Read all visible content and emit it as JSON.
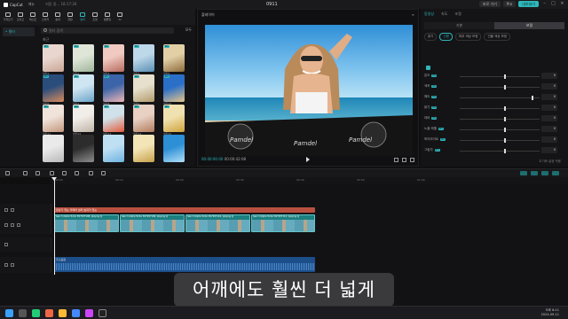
{
  "app": {
    "name": "CapCut",
    "menu": "메뉴",
    "autosave": "저장 중... 18:17:26",
    "project_title": "0911",
    "shortcut_label": "바로 가기",
    "pro_label": "Pro",
    "export_label": "내보내기"
  },
  "toolbar": {
    "items": [
      "가져오기",
      "오디오",
      "텍스트",
      "스티커",
      "효과",
      "전환",
      "필터",
      "조정",
      "템플릿",
      "AI"
    ]
  },
  "sidebar": {
    "items": [
      "• 필터"
    ]
  },
  "media": {
    "search_placeholder": "필터 검색",
    "filter_label": "모두",
    "section_title": "최근",
    "thumb_names": [
      "필터1",
      "필터2",
      "필터3",
      "필터4",
      "필터5",
      "필터6",
      "필터7",
      "필터8",
      "필터9",
      "필터10",
      "필터11",
      "필터12",
      "필터13",
      "필터14",
      "필터15",
      "",
      "",
      "",
      "",
      ""
    ]
  },
  "player": {
    "header": "플레이어",
    "current_time": "00:00:00:00",
    "total_time": "00:00:42:08",
    "brand_on_deck": "Pamdel"
  },
  "inspector": {
    "tabs": [
      "동영상",
      "속도",
      "조정"
    ],
    "subtabs": [
      "기본",
      "보정"
    ],
    "chips": [
      "밝기",
      "선명",
      "피부 색상 보정",
      "인물 색상 보정"
    ],
    "props": [
      {
        "label": "온도",
        "value": "0"
      },
      {
        "label": "색조",
        "value": "0"
      },
      {
        "label": "채도",
        "value": "0"
      },
      {
        "label": "밝기",
        "value": "0"
      },
      {
        "label": "대비",
        "value": "0"
      },
      {
        "label": "노출 레벨",
        "value": "0"
      },
      {
        "label": "하이라이트",
        "value": "0"
      },
      {
        "label": "그림자",
        "value": "0"
      }
    ],
    "reset_label": "초기화 설정 적용"
  },
  "timeline": {
    "ruler": [
      "00:00",
      "00:10",
      "00:20",
      "00:30",
      "00:40",
      "00:50",
      "01:00"
    ],
    "title_clip": "장난기 있는 카메라 필터 효과가 있는",
    "video_clips": [
      "Gen-3 Alpha Turbo 657937108, playing dj",
      "Gen-3 Alpha Turbo 657937109, playing dj",
      "Gen-3 Alpha Turbo 657937110, playing dj",
      "Gen-3 Alpha Turbo 657937111, playing dj"
    ],
    "audio_clip": "추출음원"
  },
  "subtitle": "어깨에도 훨씬 더 넓게",
  "taskbar": {
    "time": "오후 6:11",
    "date": "2024-09-11"
  },
  "colors": {
    "accent": "#2fb7ba",
    "video_track": "#1c7f80",
    "audio_track": "#1c4f8a",
    "title_track": "#b9503f"
  }
}
